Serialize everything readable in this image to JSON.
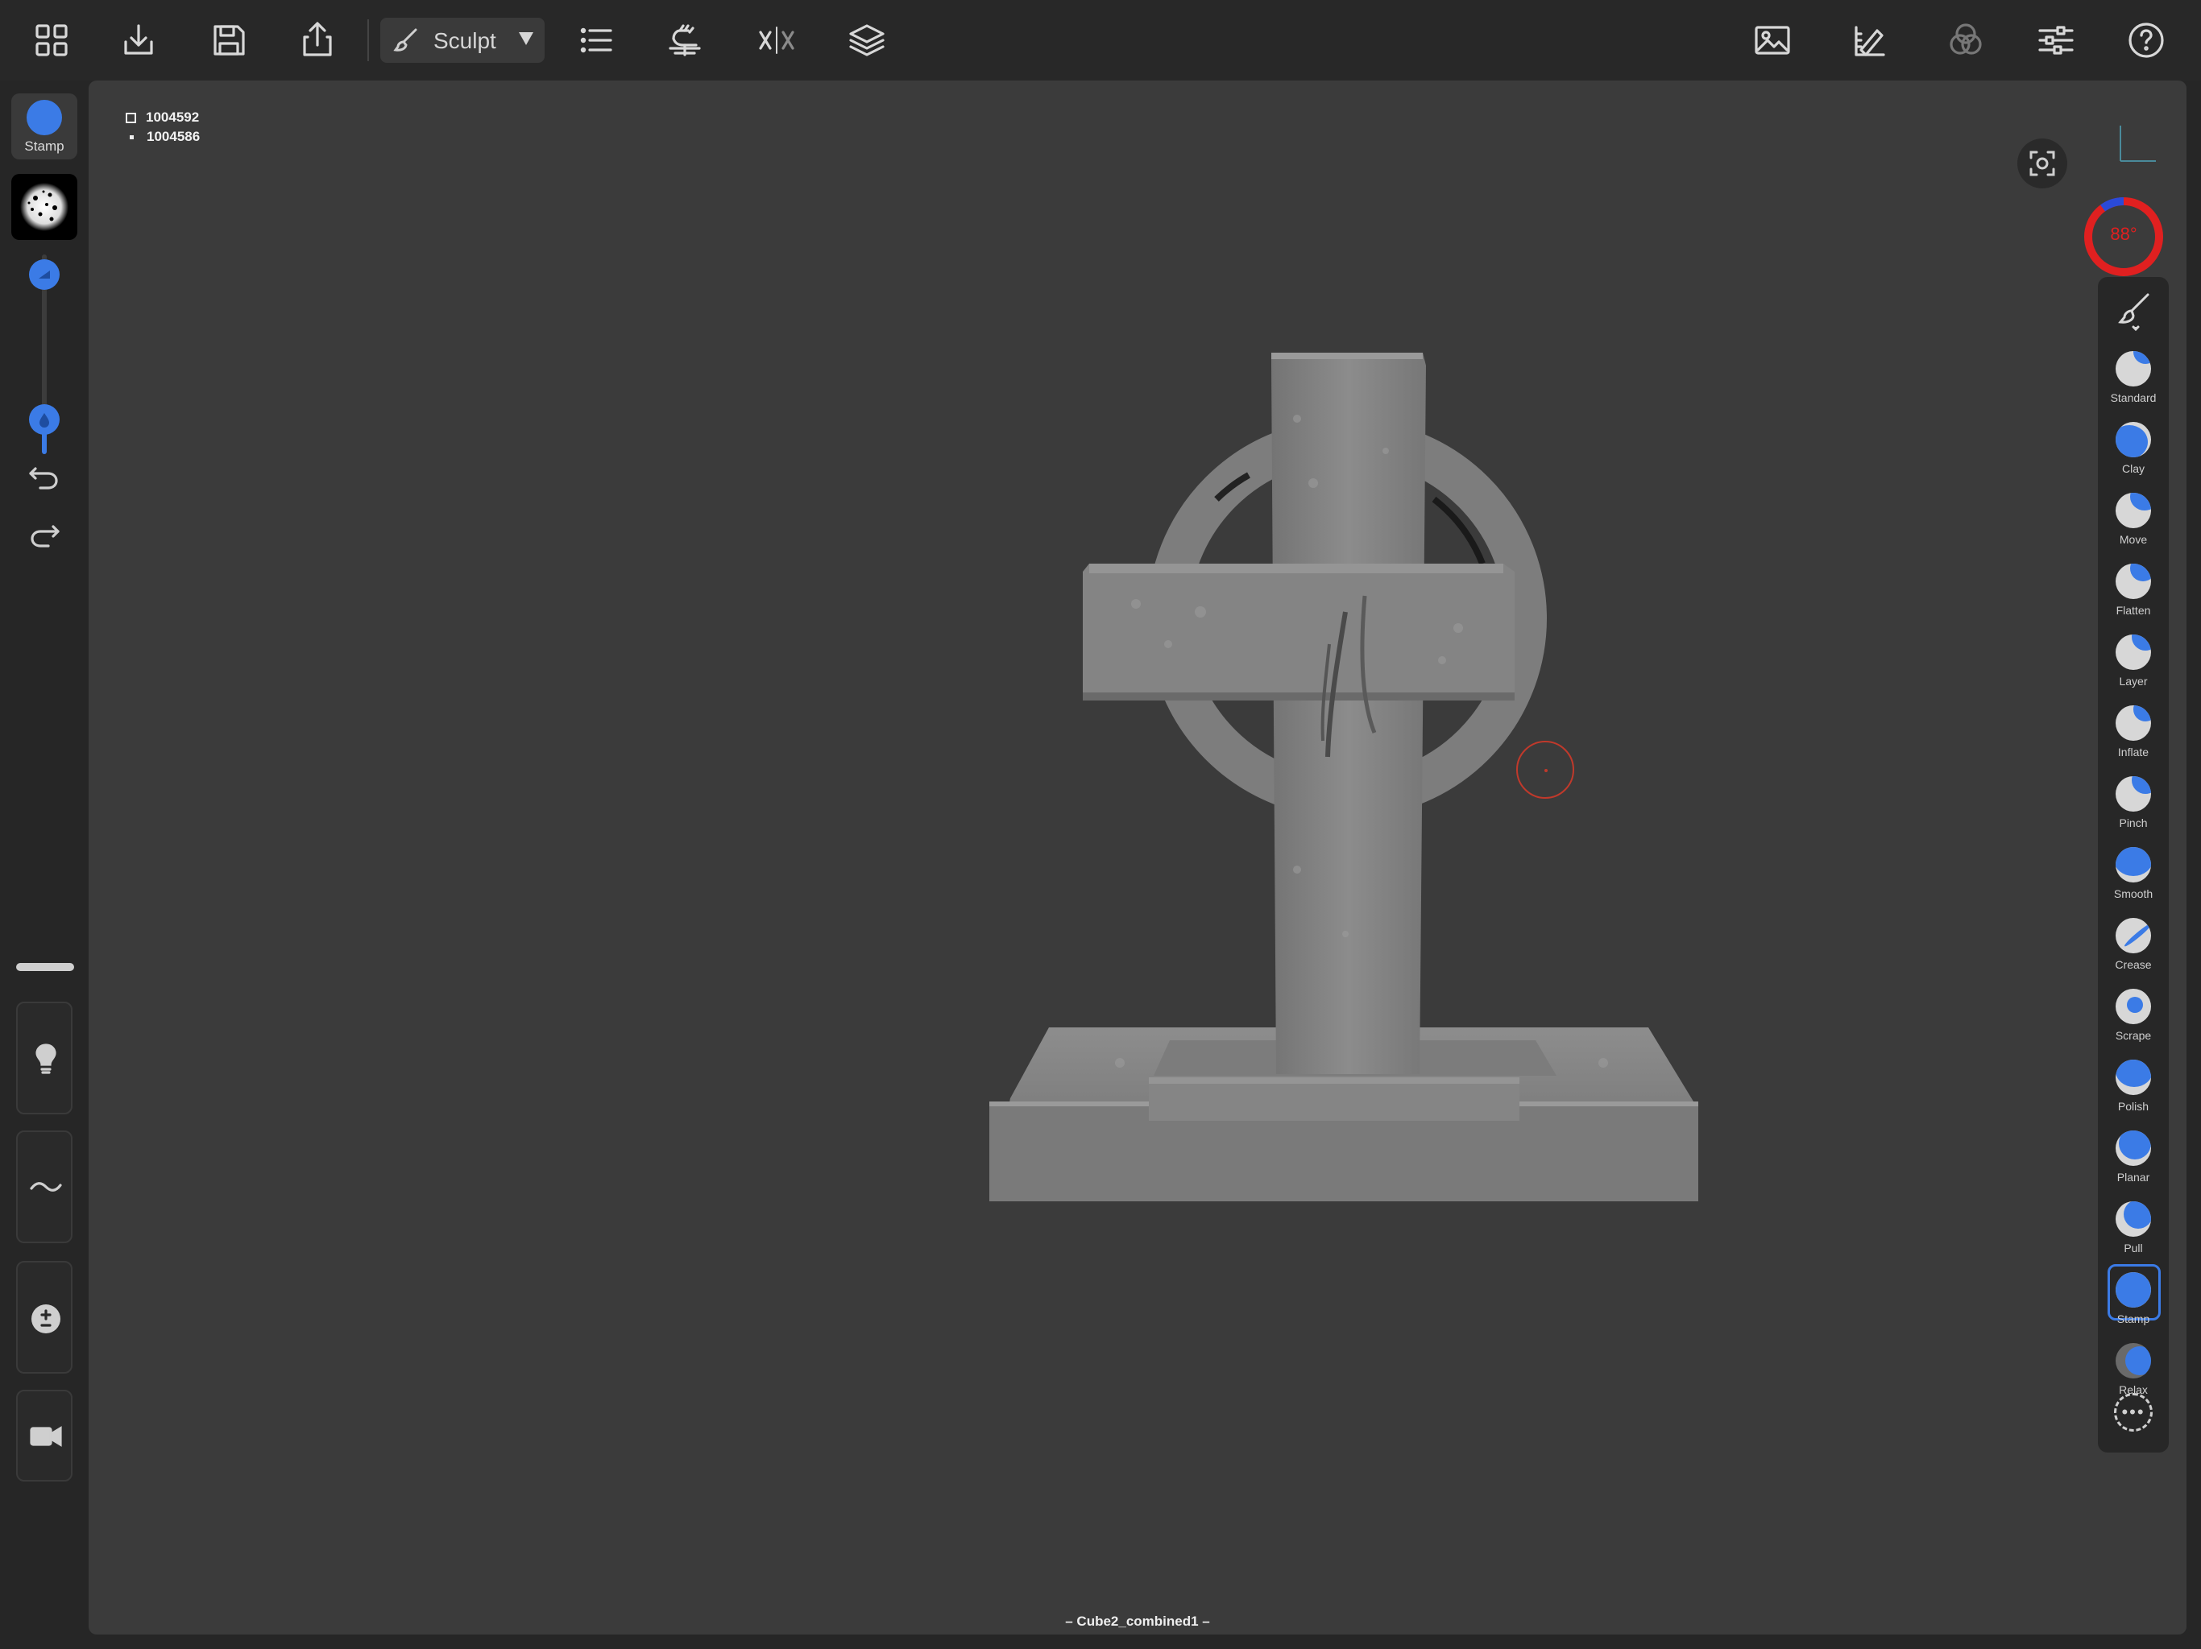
{
  "toolbar": {
    "mode_label": "Sculpt",
    "left_icons": [
      "grid-icon",
      "download-icon",
      "save-icon",
      "share-icon"
    ],
    "after_mode_icons": [
      "list-icon",
      "hand-tool-icon",
      "symmetry-icon",
      "layers-icon"
    ],
    "right_icons": [
      "image-icon",
      "ruler-icon",
      "materials-icon",
      "sliders-icon",
      "help-icon"
    ]
  },
  "left": {
    "tool_label": "Stamp",
    "radius_level": 0.11,
    "intensity_level": 0.18
  },
  "viewport": {
    "faces": "1004592",
    "vertices": "1004586",
    "mesh_name": "– Cube2_combined1 –",
    "dial_value": "88°"
  },
  "brushes": [
    {
      "label": "Standard"
    },
    {
      "label": "Clay"
    },
    {
      "label": "Move"
    },
    {
      "label": "Flatten"
    },
    {
      "label": "Layer"
    },
    {
      "label": "Inflate"
    },
    {
      "label": "Pinch"
    },
    {
      "label": "Smooth"
    },
    {
      "label": "Crease"
    },
    {
      "label": "Scrape"
    },
    {
      "label": "Polish"
    },
    {
      "label": "Planar"
    },
    {
      "label": "Pull"
    },
    {
      "label": "Stamp"
    },
    {
      "label": "Relax"
    }
  ],
  "colors": {
    "accent": "#3b7be6",
    "dial": "#e02020",
    "panel": "#272727",
    "viewport": "#3b3b3b"
  }
}
